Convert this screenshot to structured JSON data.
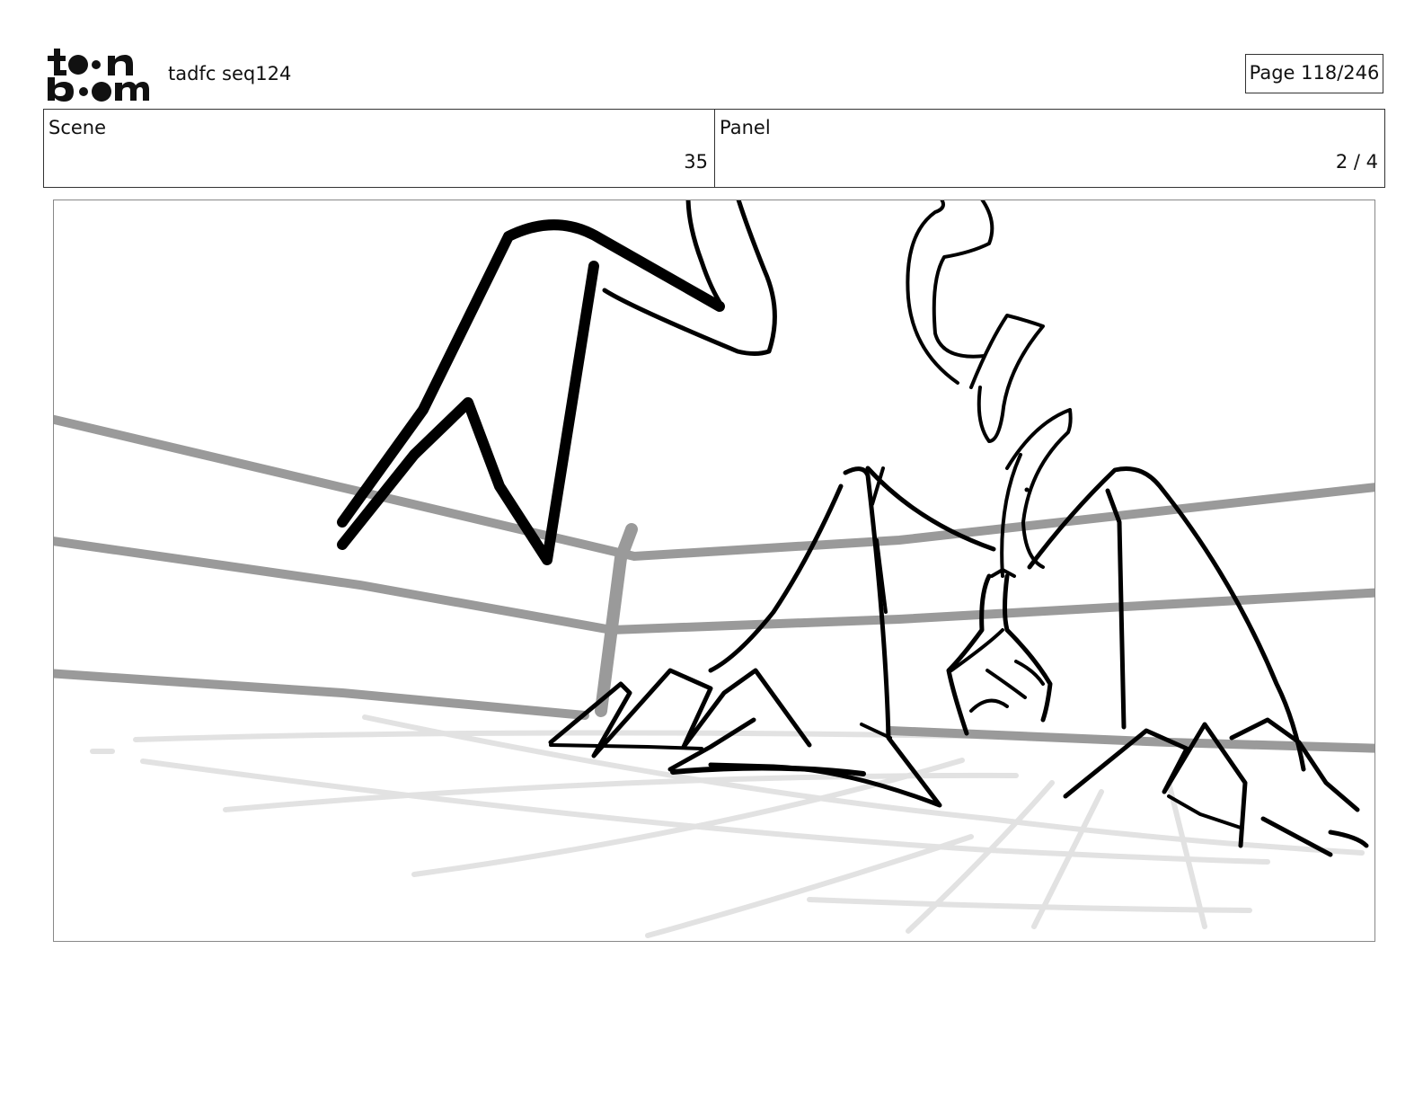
{
  "header": {
    "logo_icon": "toon-boom-logo",
    "project_title": "tadfc seq124",
    "page_label": "Page 118/246"
  },
  "info": {
    "scene_label": "Scene",
    "scene_value": "35",
    "panel_label": "Panel",
    "panel_value": "2 / 4"
  },
  "colors": {
    "ink": "#000000",
    "ropes": "#9a9a9a",
    "floor_grid": "#e2e2e2",
    "frame_border": "#888888"
  }
}
